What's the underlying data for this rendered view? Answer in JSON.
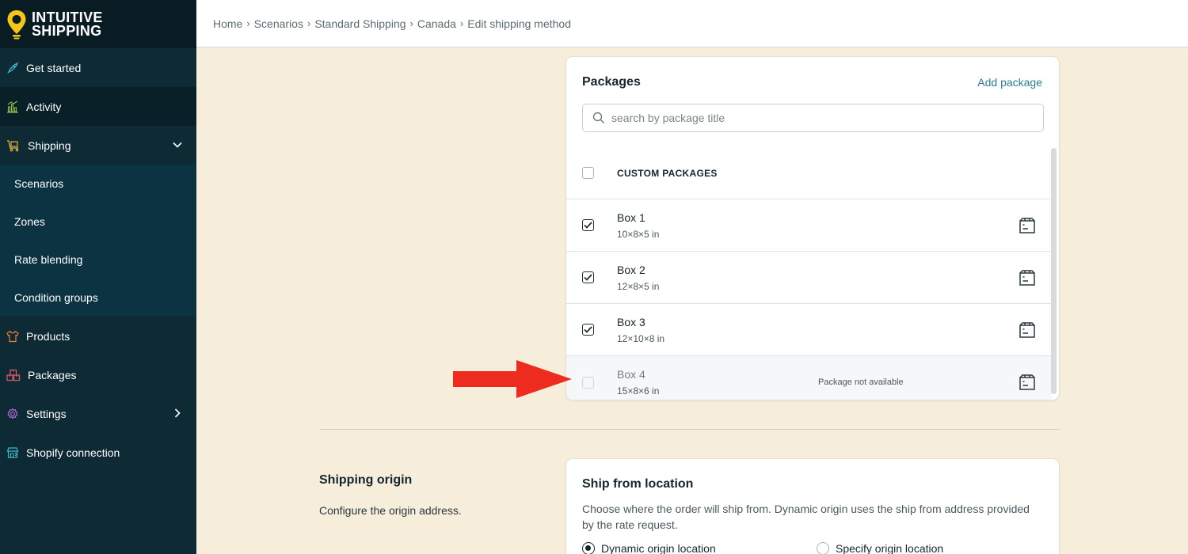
{
  "app": {
    "logo_line1": "INTUITIVE",
    "logo_line2": "SHIPPING",
    "brand_color": "#f5c518"
  },
  "sidebar": {
    "items": [
      {
        "label": "Get started",
        "icon": "rocket-icon",
        "icon_color": "#3fb6c6"
      },
      {
        "label": "Activity",
        "icon": "bar-chart-icon",
        "icon_color": "#8cc04b"
      },
      {
        "label": "Shipping",
        "icon": "truck-icon",
        "icon_color": "#e6b43c"
      },
      {
        "label": "Products",
        "icon": "shirt-icon",
        "icon_color": "#e67e3c"
      },
      {
        "label": "Packages",
        "icon": "boxes-icon",
        "icon_color": "#e65b6c"
      },
      {
        "label": "Settings",
        "icon": "gear-icon",
        "icon_color": "#b26bd6"
      },
      {
        "label": "Shopify connection",
        "icon": "store-icon",
        "icon_color": "#3fb6c6"
      }
    ],
    "shipping_sub": [
      {
        "label": "Scenarios"
      },
      {
        "label": "Zones"
      },
      {
        "label": "Rate blending"
      },
      {
        "label": "Condition groups"
      }
    ]
  },
  "breadcrumb": [
    "Home",
    "Scenarios",
    "Standard Shipping",
    "Canada",
    "Edit shipping method"
  ],
  "packages": {
    "title": "Packages",
    "add_label": "Add package",
    "search_placeholder": "search by package title",
    "header_label": "CUSTOM PACKAGES",
    "rows": [
      {
        "name": "Box 1",
        "dims": "10×8×5 in",
        "checked": true,
        "status": ""
      },
      {
        "name": "Box 2",
        "dims": "12×8×5 in",
        "checked": true,
        "status": ""
      },
      {
        "name": "Box 3",
        "dims": "12×10×8 in",
        "checked": true,
        "status": ""
      },
      {
        "name": "Box 4",
        "dims": "15×8×6 in",
        "checked": false,
        "status": "Package not available"
      }
    ]
  },
  "origin": {
    "title": "Shipping origin",
    "description": "Configure the origin address.",
    "card_title": "Ship from location",
    "card_desc": "Choose where the order will ship from. Dynamic origin uses the ship from address provided by the rate request.",
    "option_dynamic": "Dynamic origin location",
    "option_specify": "Specify origin location",
    "selected": "dynamic"
  },
  "annotation": {
    "arrow_color": "#ee2b1f"
  }
}
